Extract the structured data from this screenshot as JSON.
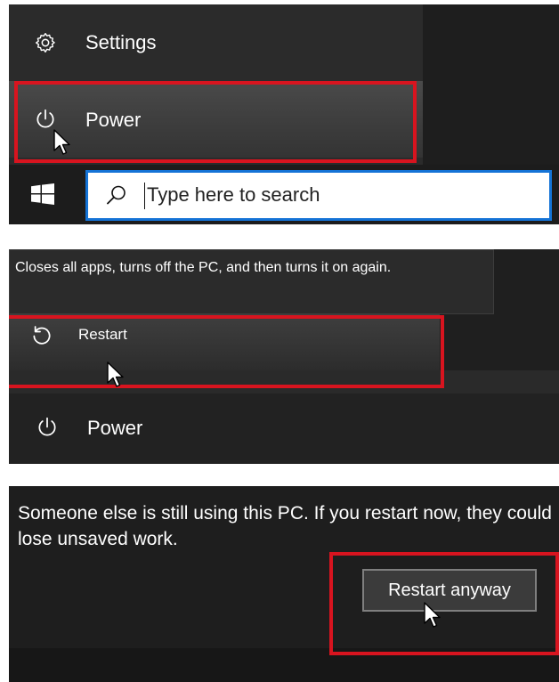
{
  "panel1": {
    "menu": {
      "settings_label": "Settings",
      "settings_icon": "gear-icon",
      "power_label": "Power",
      "power_icon": "power-icon"
    },
    "taskbar": {
      "start_icon": "windows-logo-icon",
      "search_icon": "search-icon",
      "search_placeholder": "Type here to search"
    }
  },
  "panel2": {
    "tooltip": "Closes all apps, turns off the PC, and then turns it on again.",
    "restart_label": "Restart",
    "restart_icon": "restart-icon",
    "power_label": "Power",
    "power_icon": "power-icon"
  },
  "panel3": {
    "message": "Someone else is still using this PC. If you restart now, they could lose unsaved work.",
    "button_label": "Restart anyway"
  },
  "colors": {
    "highlight": "#d8141f",
    "search_border": "#1473d6",
    "menu_bg": "#2b2b2b"
  }
}
